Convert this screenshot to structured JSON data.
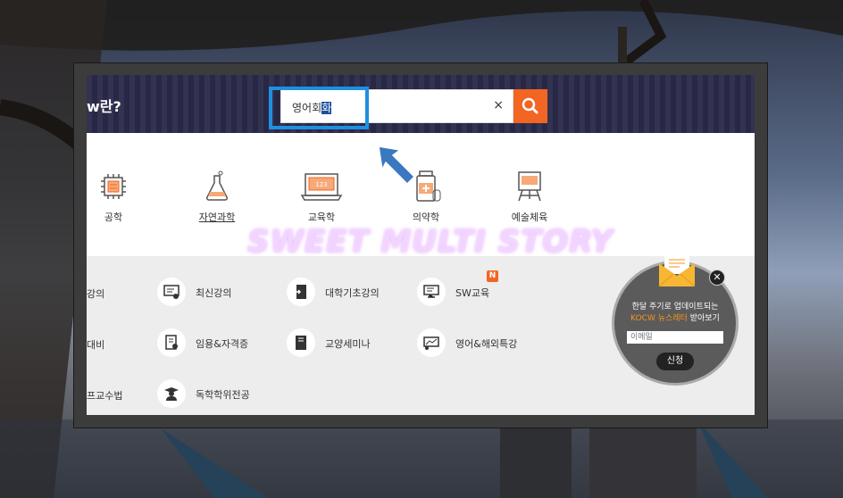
{
  "header": {
    "title": "w란?"
  },
  "search": {
    "value_plain": "영어회",
    "value_selected": "화",
    "clear_label": "×",
    "button_icon": "search-icon"
  },
  "categories": [
    {
      "label": "공학",
      "icon": "chip-icon"
    },
    {
      "label": "자연과학",
      "icon": "flask-icon"
    },
    {
      "label": "교육학",
      "icon": "laptop-icon"
    },
    {
      "label": "의약학",
      "icon": "medicine-icon"
    },
    {
      "label": "예술체육",
      "icon": "easel-icon"
    }
  ],
  "watermark": "SWEET MULTI STORY",
  "menu": {
    "cut_items": [
      "강의",
      "대비",
      "프교수법"
    ],
    "items": [
      {
        "label": "최신강의",
        "icon": "board-icon"
      },
      {
        "label": "대학기초강의",
        "icon": "door-icon"
      },
      {
        "label": "SW교육",
        "icon": "monitor-icon",
        "badge": "N"
      },
      {
        "label": "임용&자격증",
        "icon": "certificate-icon"
      },
      {
        "label": "교양세미나",
        "icon": "book-icon"
      },
      {
        "label": "영어&해외특강",
        "icon": "presentation-icon"
      },
      {
        "label": "독학학위전공",
        "icon": "graduate-icon"
      }
    ]
  },
  "newsletter": {
    "line1": "한달 주기로 업데이트되는",
    "line2_highlight": "KOCW 뉴스레터",
    "line2_rest": " 받아보기",
    "email_placeholder": "이메일",
    "submit_label": "신청",
    "close_label": "✕"
  },
  "colors": {
    "accent": "#f26522",
    "header_bg": "#2a2a4a",
    "highlight": "#1e90e0",
    "arrow": "#3a78c0"
  }
}
